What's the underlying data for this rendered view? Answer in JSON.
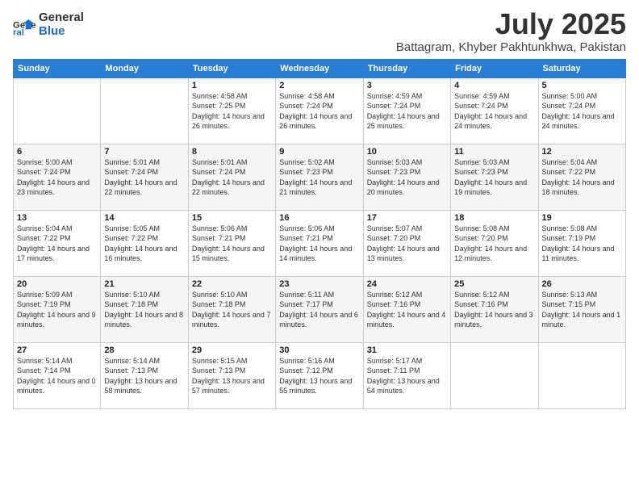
{
  "logo": {
    "general": "General",
    "blue": "Blue"
  },
  "title": "July 2025",
  "subtitle": "Battagram, Khyber Pakhtunkhwa, Pakistan",
  "days_of_week": [
    "Sunday",
    "Monday",
    "Tuesday",
    "Wednesday",
    "Thursday",
    "Friday",
    "Saturday"
  ],
  "weeks": [
    [
      {
        "day": "",
        "info": ""
      },
      {
        "day": "",
        "info": ""
      },
      {
        "day": "1",
        "info": "Sunrise: 4:58 AM\nSunset: 7:25 PM\nDaylight: 14 hours and 26 minutes."
      },
      {
        "day": "2",
        "info": "Sunrise: 4:58 AM\nSunset: 7:24 PM\nDaylight: 14 hours and 26 minutes."
      },
      {
        "day": "3",
        "info": "Sunrise: 4:59 AM\nSunset: 7:24 PM\nDaylight: 14 hours and 25 minutes."
      },
      {
        "day": "4",
        "info": "Sunrise: 4:59 AM\nSunset: 7:24 PM\nDaylight: 14 hours and 24 minutes."
      },
      {
        "day": "5",
        "info": "Sunrise: 5:00 AM\nSunset: 7:24 PM\nDaylight: 14 hours and 24 minutes."
      }
    ],
    [
      {
        "day": "6",
        "info": "Sunrise: 5:00 AM\nSunset: 7:24 PM\nDaylight: 14 hours and 23 minutes."
      },
      {
        "day": "7",
        "info": "Sunrise: 5:01 AM\nSunset: 7:24 PM\nDaylight: 14 hours and 22 minutes."
      },
      {
        "day": "8",
        "info": "Sunrise: 5:01 AM\nSunset: 7:24 PM\nDaylight: 14 hours and 22 minutes."
      },
      {
        "day": "9",
        "info": "Sunrise: 5:02 AM\nSunset: 7:23 PM\nDaylight: 14 hours and 21 minutes."
      },
      {
        "day": "10",
        "info": "Sunrise: 5:03 AM\nSunset: 7:23 PM\nDaylight: 14 hours and 20 minutes."
      },
      {
        "day": "11",
        "info": "Sunrise: 5:03 AM\nSunset: 7:23 PM\nDaylight: 14 hours and 19 minutes."
      },
      {
        "day": "12",
        "info": "Sunrise: 5:04 AM\nSunset: 7:22 PM\nDaylight: 14 hours and 18 minutes."
      }
    ],
    [
      {
        "day": "13",
        "info": "Sunrise: 5:04 AM\nSunset: 7:22 PM\nDaylight: 14 hours and 17 minutes."
      },
      {
        "day": "14",
        "info": "Sunrise: 5:05 AM\nSunset: 7:22 PM\nDaylight: 14 hours and 16 minutes."
      },
      {
        "day": "15",
        "info": "Sunrise: 5:06 AM\nSunset: 7:21 PM\nDaylight: 14 hours and 15 minutes."
      },
      {
        "day": "16",
        "info": "Sunrise: 5:06 AM\nSunset: 7:21 PM\nDaylight: 14 hours and 14 minutes."
      },
      {
        "day": "17",
        "info": "Sunrise: 5:07 AM\nSunset: 7:20 PM\nDaylight: 14 hours and 13 minutes."
      },
      {
        "day": "18",
        "info": "Sunrise: 5:08 AM\nSunset: 7:20 PM\nDaylight: 14 hours and 12 minutes."
      },
      {
        "day": "19",
        "info": "Sunrise: 5:08 AM\nSunset: 7:19 PM\nDaylight: 14 hours and 11 minutes."
      }
    ],
    [
      {
        "day": "20",
        "info": "Sunrise: 5:09 AM\nSunset: 7:19 PM\nDaylight: 14 hours and 9 minutes."
      },
      {
        "day": "21",
        "info": "Sunrise: 5:10 AM\nSunset: 7:18 PM\nDaylight: 14 hours and 8 minutes."
      },
      {
        "day": "22",
        "info": "Sunrise: 5:10 AM\nSunset: 7:18 PM\nDaylight: 14 hours and 7 minutes."
      },
      {
        "day": "23",
        "info": "Sunrise: 5:11 AM\nSunset: 7:17 PM\nDaylight: 14 hours and 6 minutes."
      },
      {
        "day": "24",
        "info": "Sunrise: 5:12 AM\nSunset: 7:16 PM\nDaylight: 14 hours and 4 minutes."
      },
      {
        "day": "25",
        "info": "Sunrise: 5:12 AM\nSunset: 7:16 PM\nDaylight: 14 hours and 3 minutes."
      },
      {
        "day": "26",
        "info": "Sunrise: 5:13 AM\nSunset: 7:15 PM\nDaylight: 14 hours and 1 minute."
      }
    ],
    [
      {
        "day": "27",
        "info": "Sunrise: 5:14 AM\nSunset: 7:14 PM\nDaylight: 14 hours and 0 minutes."
      },
      {
        "day": "28",
        "info": "Sunrise: 5:14 AM\nSunset: 7:13 PM\nDaylight: 13 hours and 58 minutes."
      },
      {
        "day": "29",
        "info": "Sunrise: 5:15 AM\nSunset: 7:13 PM\nDaylight: 13 hours and 57 minutes."
      },
      {
        "day": "30",
        "info": "Sunrise: 5:16 AM\nSunset: 7:12 PM\nDaylight: 13 hours and 55 minutes."
      },
      {
        "day": "31",
        "info": "Sunrise: 5:17 AM\nSunset: 7:11 PM\nDaylight: 13 hours and 54 minutes."
      },
      {
        "day": "",
        "info": ""
      },
      {
        "day": "",
        "info": ""
      }
    ]
  ]
}
